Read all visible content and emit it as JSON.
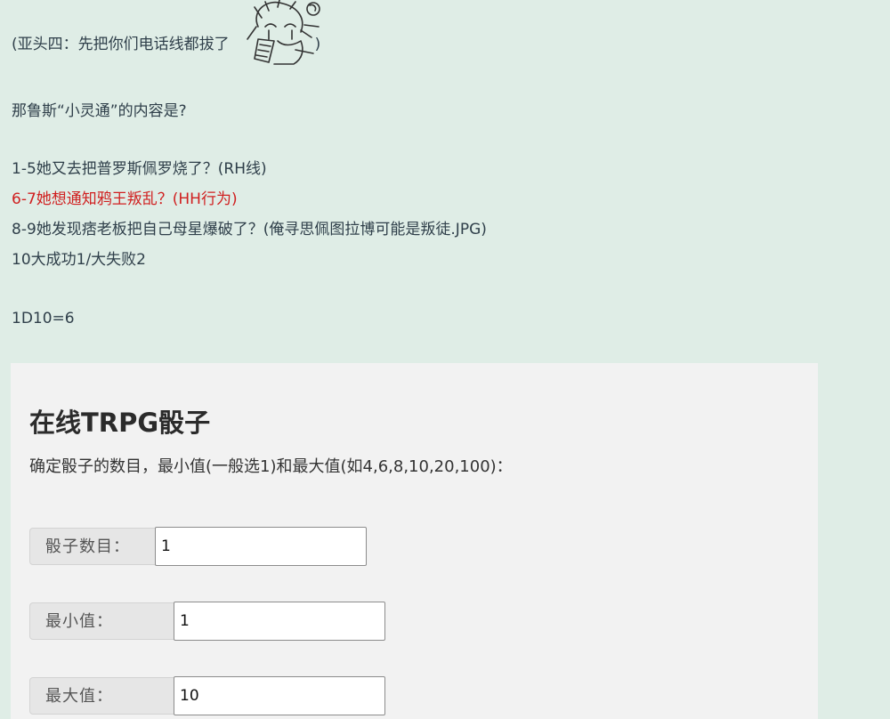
{
  "post": {
    "line1_prefix": "(亚头四：先把你们电话线都拔了",
    "line1_suffix": ")",
    "question": "那鲁斯“小灵通”的内容是?",
    "options": [
      "1-5她又去把普罗斯佩罗烧了？(RH线)",
      "6-7她想通知鸦王叛乱？(HH行为)",
      "8-9她发现痞老板把自己母星爆破了？(俺寻思佩图拉博可能是叛徒.JPG)",
      "10大成功1/大失败2"
    ],
    "roll_result": "1D10=6",
    "highlight_color": "#d02020"
  },
  "dice_tool": {
    "title": "在线TRPG骰子",
    "description": "确定骰子的数目，最小值(一般选1)和最大值(如4,6,8,10,20,100)：",
    "fields": [
      {
        "label": "骰子数目：",
        "value": "1"
      },
      {
        "label": "最小值：",
        "value": "1"
      },
      {
        "label": "最大值：",
        "value": "10"
      }
    ]
  }
}
